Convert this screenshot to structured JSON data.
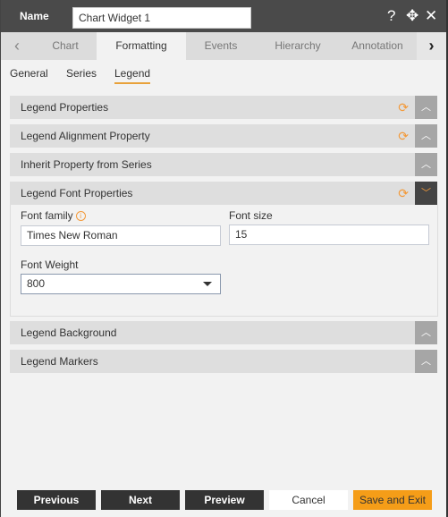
{
  "header": {
    "name_label": "Name",
    "name_value": "Chart Widget 1",
    "icons": [
      "help-icon",
      "move-icon",
      "close-icon"
    ]
  },
  "tabs": {
    "items": [
      {
        "label": "Chart"
      },
      {
        "label": "Formatting",
        "active": true
      },
      {
        "label": "Events"
      },
      {
        "label": "Hierarchy"
      },
      {
        "label": "Annotation"
      }
    ]
  },
  "subtabs": {
    "items": [
      {
        "label": "General"
      },
      {
        "label": "Series"
      },
      {
        "label": "Legend",
        "active": true
      }
    ]
  },
  "sections": [
    {
      "title": "Legend Properties",
      "refresh": true,
      "expanded": false
    },
    {
      "title": "Legend Alignment Property",
      "refresh": true,
      "expanded": false
    },
    {
      "title": "Inherit Property from Series",
      "refresh": false,
      "expanded": false
    },
    {
      "title": "Legend Font Properties",
      "refresh": true,
      "expanded": true
    },
    {
      "title": "Legend Background",
      "refresh": false,
      "expanded": false
    },
    {
      "title": "Legend Markers",
      "refresh": false,
      "expanded": false
    }
  ],
  "font": {
    "family_label": "Font family",
    "family_value": "Times New Roman",
    "size_label": "Font size",
    "size_value": "15",
    "weight_label": "Font Weight",
    "weight_value": "800"
  },
  "footer": {
    "previous": "Previous",
    "next": "Next",
    "preview": "Preview",
    "cancel": "Cancel",
    "save_exit": "Save and Exit"
  },
  "colors": {
    "accent": "#f39a3a",
    "save_button": "#f59d18",
    "header": "#4a4a4a"
  }
}
